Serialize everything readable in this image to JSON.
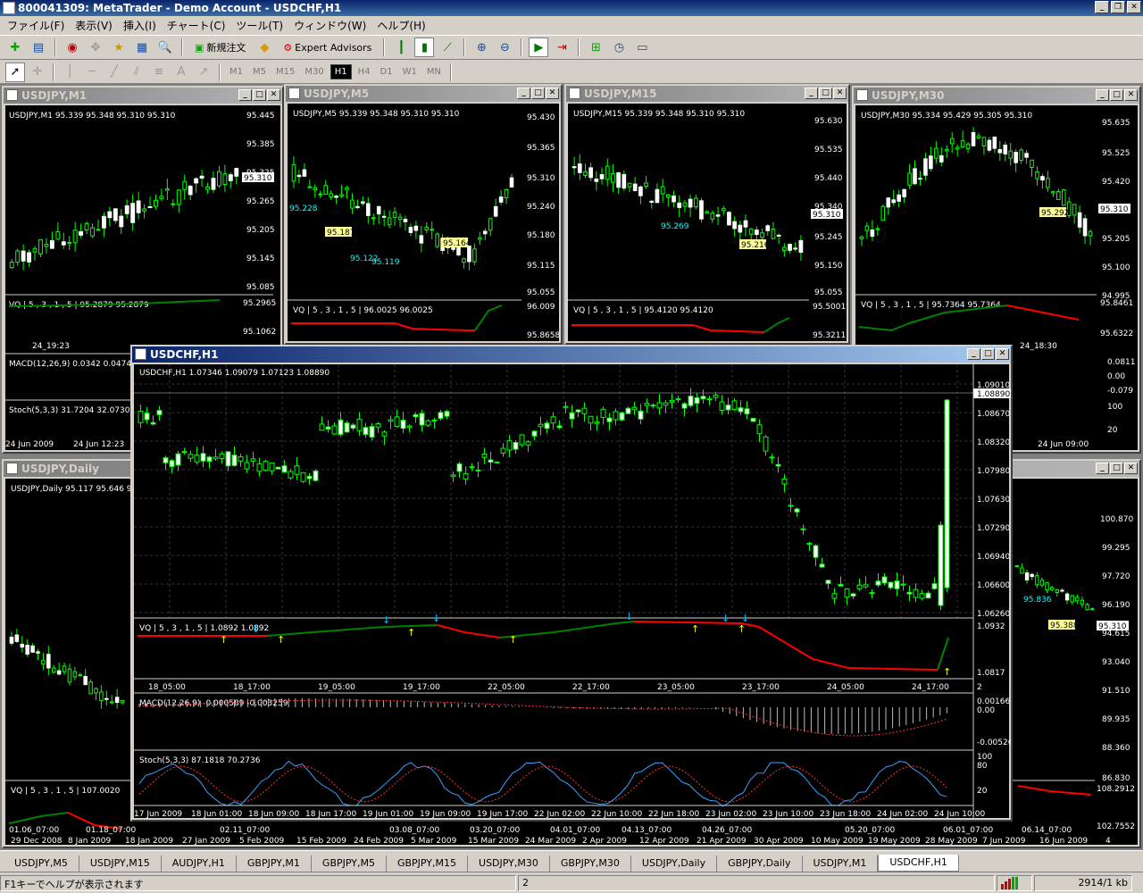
{
  "app": {
    "title": "800041309: MetaTrader - Demo Account - USDCHF,H1",
    "minimize": "_",
    "restore": "❐",
    "close": "✕"
  },
  "menu": [
    "ファイル(F)",
    "表示(V)",
    "挿入(I)",
    "チャート(C)",
    "ツール(T)",
    "ウィンドウ(W)",
    "ヘルプ(H)"
  ],
  "toolbar": {
    "new_order": "新規注文",
    "expert_advisors": "Expert Advisors"
  },
  "timeframes": [
    "M1",
    "M5",
    "M15",
    "M30",
    "H1",
    "H4",
    "D1",
    "W1",
    "MN"
  ],
  "active_timeframe": "H1",
  "windows": {
    "m1": {
      "title": "USDJPY,M1",
      "info": "USDJPY,M1  95.339 95.348 95.310 95.310",
      "prices": [
        "95.445",
        "95.385",
        "95.325",
        "95.265",
        "95.205",
        "95.145",
        "95.085"
      ],
      "current": "95.310",
      "vq": "VQ | 5 , 3 , 1 , 5  |  95.2879 95.2879",
      "vq_prices": [
        "95.2965",
        "95.1062"
      ],
      "time_label": "24_19:23",
      "macd": "MACD(12,26,9) 0.0342 0.0474",
      "stoch": "Stoch(5,3,3) 31.7204 32.0730",
      "dates": [
        "24 Jun 2009",
        "24 Jun 12:23"
      ]
    },
    "m5": {
      "title": "USDJPY,M5",
      "info": "USDJPY,M5  95.339 95.348 95.310 95.310",
      "prices": [
        "95.430",
        "95.365",
        "95.310",
        "95.240",
        "95.180",
        "95.115",
        "95.055"
      ],
      "current": "95.310",
      "labels": [
        "95.187",
        "95.164",
        "95.122",
        "95.119",
        "95.228"
      ],
      "vq": "VQ | 5 , 3 , 1 , 5  |  96.0025 96.0025",
      "vq_prices": [
        "96.009",
        "95.8658"
      ]
    },
    "m15": {
      "title": "USDJPY,M15",
      "info": "USDJPY,M15  95.339 95.348 95.310 95.310",
      "prices": [
        "95.630",
        "95.535",
        "95.440",
        "95.340",
        "95.245",
        "95.150",
        "95.055"
      ],
      "current": "95.310",
      "labels": [
        "95.269",
        "95.216"
      ],
      "vq": "VQ | 5 , 3 , 1 , 5  |  95.4120 95.4120",
      "vq_prices": [
        "95.5001",
        "95.3211"
      ]
    },
    "m30": {
      "title": "USDJPY,M30",
      "info": "USDJPY,M30  95.334 95.429 95.305 95.310",
      "prices": [
        "95.635",
        "95.525",
        "95.420",
        "95.310",
        "95.205",
        "95.100",
        "94.995"
      ],
      "current": "95.310",
      "labels": [
        "95.292"
      ],
      "vq": "VQ | 5 , 3 , 1 , 5  |  95.7364 95.7364",
      "vq_prices": [
        "95.8461",
        "95.6322"
      ],
      "time_label": "24_18:30",
      "ind_prices": [
        "0.0811",
        "0.00",
        "-0.079",
        "100",
        "80",
        "20"
      ],
      "date": "24 Jun 09:00"
    },
    "daily": {
      "title": "USDJPY,Daily",
      "info": "USDJPY,Daily  95.117 95.646 9",
      "vq": "VQ | 5 , 3 , 1 , 5  |  107.0020",
      "dates": [
        "29 Dec 2008",
        "8 Jan 2009",
        "18 Jan 2009",
        "27 Jan 2009",
        "5 Feb 2009",
        "15 Feb 2009",
        "24 Feb 2009",
        "5 Mar 2009",
        "15 Mar 2009",
        "24 Mar 2009",
        "2 Apr 2009",
        "12 Apr 2009",
        "21 Apr 2009",
        "30 Apr 2009",
        "10 May 2009",
        "19 May 2009",
        "28 May 2009",
        "7 Jun 2009",
        "16 Jun 2009"
      ],
      "vq_times": [
        "01.06_07:00",
        "01.18_07:00",
        "02.11_07:00",
        "03.08_07:00",
        "03.20_07:00",
        "04.01_07:00",
        "04.13_07:00",
        "04.26_07:00",
        "05.20_07:00",
        "06.01_07:00",
        "06.14_07:00"
      ]
    },
    "right": {
      "prices": [
        "100.870",
        "99.295",
        "97.720",
        "96.190",
        "94.615",
        "93.040",
        "91.510",
        "89.935",
        "88.360",
        "86.830"
      ],
      "current": "95.310",
      "labels": [
        "95.388",
        "95.836"
      ],
      "vq_prices": [
        "108.2912",
        "102.7552"
      ],
      "top_price": "4"
    },
    "main": {
      "title": "USDCHF,H1",
      "info": "USDCHF,H1  1.07346 1.09079 1.07123 1.08890",
      "prices": [
        "1.09010",
        "1.08670",
        "1.08320",
        "1.07980",
        "1.07630",
        "1.07290",
        "1.06940",
        "1.06600",
        "1.06260"
      ],
      "current": "1.08890",
      "vq": "VQ | 5 , 3 , 1 , 5  |  1.0892 1.0892",
      "vq_prices": [
        "1.0932",
        "1.0817"
      ],
      "vq_times": [
        "18_05:00",
        "18_17:00",
        "19_05:00",
        "19_17:00",
        "22_05:00",
        "22_17:00",
        "23_05:00",
        "23_17:00",
        "24_05:00",
        "24_17:00"
      ],
      "macd": "MACD(12,26,9) -0.000589 -0.003259",
      "macd_prices": [
        "0.001664",
        "0.00",
        "-0.00526"
      ],
      "stoch": "Stoch(5,3,3) 87.1818 70.2736",
      "stoch_prices": [
        "100",
        "80",
        "20",
        "0"
      ],
      "dates": [
        "17 Jun 2009",
        "18 Jun 01:00",
        "18 Jun 09:00",
        "18 Jun 17:00",
        "19 Jun 01:00",
        "19 Jun 09:00",
        "19 Jun 17:00",
        "22 Jun 02:00",
        "22 Jun 10:00",
        "22 Jun 18:00",
        "23 Jun 02:00",
        "23 Jun 10:00",
        "23 Jun 18:00",
        "24 Jun 02:00",
        "24 Jun 10:00"
      ],
      "sep_label": "2"
    }
  },
  "tabs": [
    "USDJPY,M5",
    "USDJPY,M15",
    "AUDJPY,H1",
    "GBPJPY,M1",
    "GBPJPY,M5",
    "GBPJPY,M15",
    "USDJPY,M30",
    "GBPJPY,M30",
    "USDJPY,Daily",
    "GBPJPY,Daily",
    "USDJPY,M1",
    "USDCHF,H1"
  ],
  "active_tab": "USDCHF,H1",
  "status": {
    "help": "F1キーでヘルプが表示されます",
    "profile": "2",
    "traffic": "2914/1 kb"
  },
  "colors": {
    "bull": "#ffffff",
    "bear": "#00ff00",
    "grid": "#3a3a3a",
    "vq_up": "#008000",
    "vq_down": "#ff0000",
    "arrow_up": "#ffff00",
    "arrow_down": "#00bfff",
    "label_yellow": "#ffff99",
    "label_cyan": "#00ffff"
  }
}
